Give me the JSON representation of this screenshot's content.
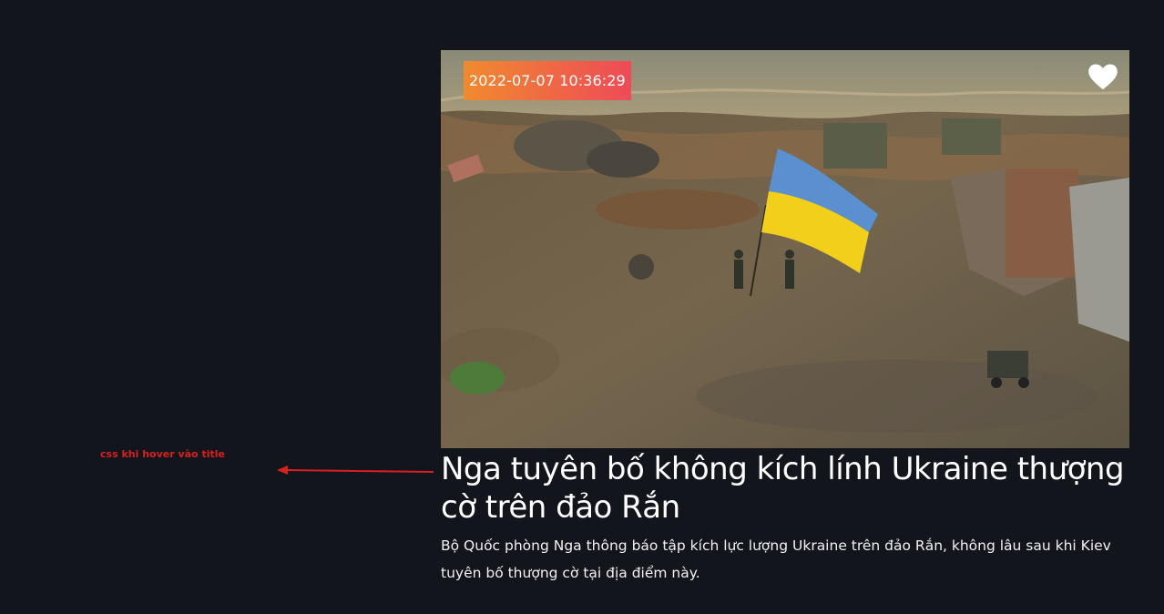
{
  "annotation": {
    "label": "css khi hover vào title",
    "color": "#d8201e"
  },
  "card": {
    "date": "2022-07-07 10:36:29",
    "title": "Nga tuyên bố không kích lính Ukraine thượng cờ trên đảo Rắn",
    "description": "Bộ Quốc phòng Nga thông báo tập kích lực lượng Ukraine trên đảo Rắn, không lâu sau khi Kiev tuyên bố thượng cờ tại địa điểm này.",
    "image_icon": "heart-icon",
    "badge_colors": [
      "#f08a2f",
      "#ee4a58"
    ]
  },
  "colors": {
    "background": "#13151d",
    "text": "#ffffff"
  }
}
